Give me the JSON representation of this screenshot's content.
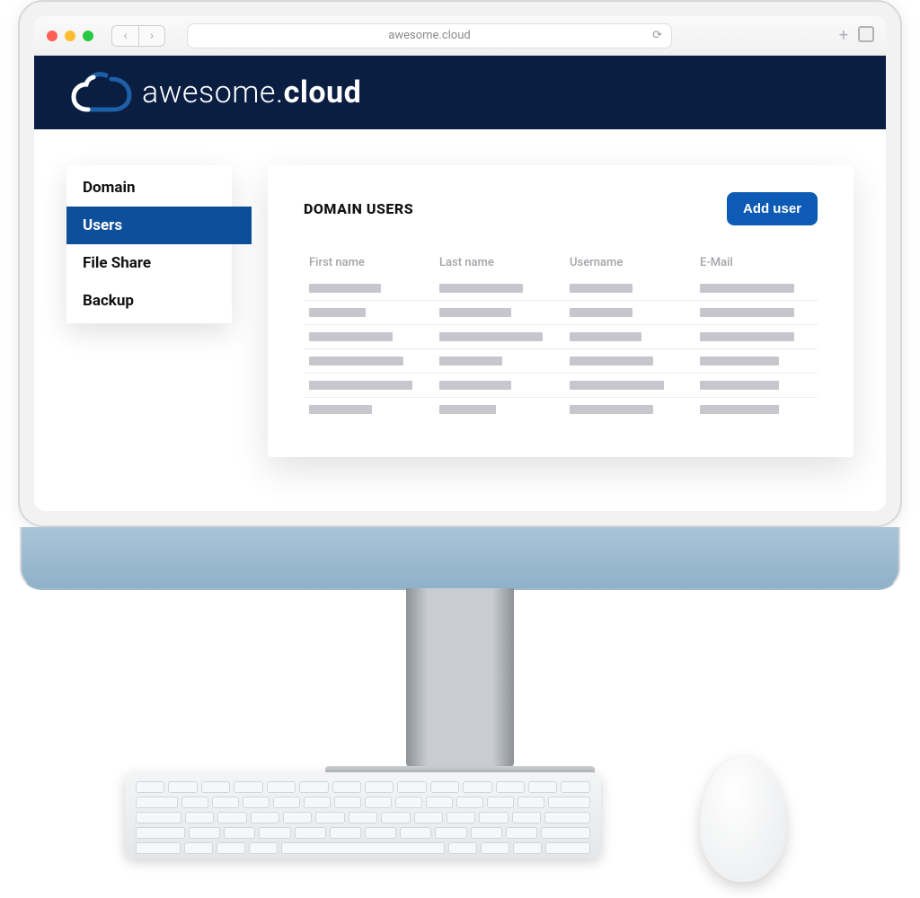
{
  "browser": {
    "url": "awesome.cloud"
  },
  "brand": {
    "text_light": "awesome.",
    "text_bold": "cloud"
  },
  "sidebar": {
    "items": [
      {
        "label": "Domain",
        "active": false
      },
      {
        "label": "Users",
        "active": true
      },
      {
        "label": "File Share",
        "active": false
      },
      {
        "label": "Backup",
        "active": false
      }
    ]
  },
  "panel": {
    "title": "DOMAIN USERS",
    "add_button": "Add user",
    "columns": [
      "First name",
      "Last name",
      "Username",
      "E-Mail"
    ],
    "row_count": 6
  }
}
